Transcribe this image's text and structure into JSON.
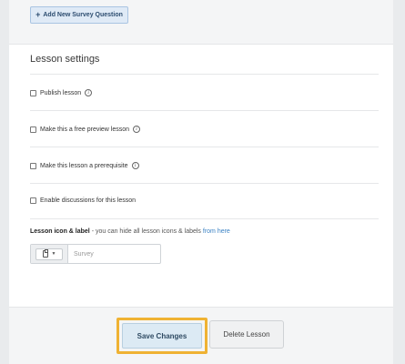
{
  "survey": {
    "add_question_label": "Add New Survey Question",
    "plus_icon": "plus-icon"
  },
  "settings": {
    "title": "Lesson settings",
    "options": [
      {
        "label": "Publish lesson",
        "has_info": true,
        "checked": false
      },
      {
        "label": "Make this a free preview lesson",
        "has_info": true,
        "checked": false
      },
      {
        "label": "Make this lesson a prerequisite",
        "has_info": true,
        "checked": false
      },
      {
        "label": "Enable discussions for this lesson",
        "has_info": false,
        "checked": false
      }
    ],
    "info_glyph": "i"
  },
  "icon_label": {
    "heading": "Lesson icon & label",
    "note": " - you can hide all lesson icons & labels ",
    "link": "from here",
    "input_placeholder": "Survey",
    "input_value": "",
    "selected_icon": "clipboard-icon"
  },
  "footer": {
    "save_label": "Save Changes",
    "delete_label": "Delete Lesson",
    "highlight_color": "#efb233"
  }
}
